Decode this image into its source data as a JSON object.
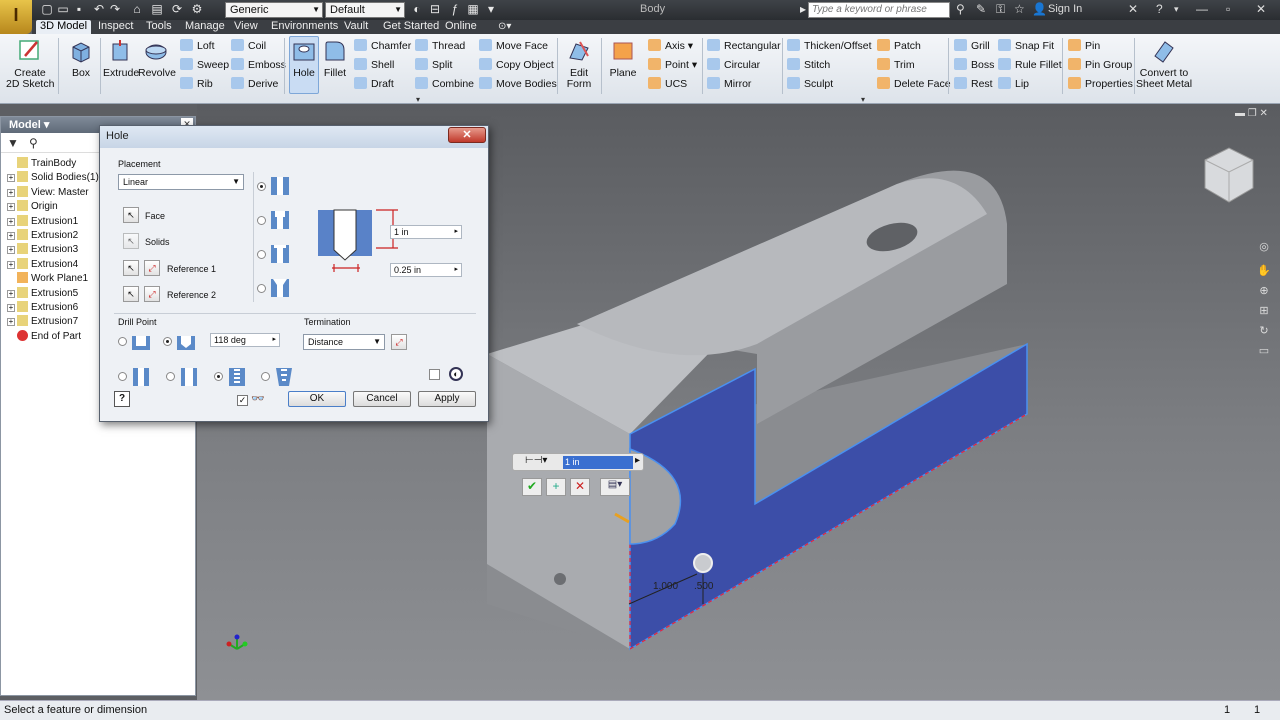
{
  "titlebar": {
    "app_logo": "I",
    "appearance_combo": "Generic",
    "material_combo": "Default",
    "document_title": "Body",
    "search_placeholder": "Type a keyword or phrase",
    "sign_in": "Sign In"
  },
  "tabs": [
    "3D Model",
    "Inspect",
    "Tools",
    "Manage",
    "View",
    "Environments",
    "Vault",
    "Get Started",
    "Online"
  ],
  "ribbon": {
    "create_sketch": "Create\n2D Sketch",
    "box": "Box",
    "extrude": "Extrude",
    "revolve": "Revolve",
    "col1": [
      "Loft",
      "Sweep",
      "Rib"
    ],
    "col2": [
      "Coil",
      "Emboss",
      "Derive"
    ],
    "hole": "Hole",
    "fillet": "Fillet",
    "col3": [
      "Chamfer",
      "Shell",
      "Draft"
    ],
    "col4": [
      "Thread",
      "Split",
      "Combine"
    ],
    "col5": [
      "Move Face",
      "Copy Object",
      "Move Bodies"
    ],
    "edit_form": "Edit\nForm",
    "plane": "Plane",
    "work_features": [
      "Axis",
      "Point",
      "UCS"
    ],
    "pattern": [
      "Rectangular",
      "Circular",
      "Mirror"
    ],
    "surface": [
      "Thicken/Offset",
      "Stitch",
      "Sculpt"
    ],
    "surface2": [
      "Patch",
      "Trim",
      "Delete Face"
    ],
    "plastic": [
      "Grill",
      "Boss",
      "Rest"
    ],
    "plastic2": [
      "Snap Fit",
      "Rule Fillet",
      "Lip"
    ],
    "harness": [
      "Pin",
      "Pin Group",
      "Properties"
    ],
    "convert": "Convert to\nSheet Metal"
  },
  "browser": {
    "header": "Model ▾",
    "items": [
      {
        "label": "TrainBody",
        "indent": 0,
        "expander": false
      },
      {
        "label": "Solid Bodies(1)",
        "indent": 1,
        "expander": true
      },
      {
        "label": "View: Master",
        "indent": 1,
        "expander": true
      },
      {
        "label": "Origin",
        "indent": 1,
        "expander": true
      },
      {
        "label": "Extrusion1",
        "indent": 1,
        "expander": true
      },
      {
        "label": "Extrusion2",
        "indent": 1,
        "expander": true
      },
      {
        "label": "Extrusion3",
        "indent": 1,
        "expander": true
      },
      {
        "label": "Extrusion4",
        "indent": 1,
        "expander": true
      },
      {
        "label": "Work Plane1",
        "indent": 1,
        "expander": false
      },
      {
        "label": "Extrusion5",
        "indent": 1,
        "expander": true
      },
      {
        "label": "Extrusion6",
        "indent": 1,
        "expander": true
      },
      {
        "label": "Extrusion7",
        "indent": 1,
        "expander": true
      },
      {
        "label": "End of Part",
        "indent": 1,
        "expander": false
      }
    ]
  },
  "dialog": {
    "title": "Hole",
    "close": "✕",
    "placement_label": "Placement",
    "placement_value": "Linear",
    "face": "Face",
    "solids": "Solids",
    "reference1": "Reference 1",
    "reference2": "Reference 2",
    "depth_value": "1 in",
    "diameter_value": "0.25 in",
    "drill_point_label": "Drill Point",
    "drill_angle": "118 deg",
    "termination_label": "Termination",
    "termination_value": "Distance",
    "ok": "OK",
    "cancel": "Cancel",
    "apply": "Apply",
    "help": "?"
  },
  "minitoolbar": {
    "value": "1 in"
  },
  "dimensions": [
    "1.000",
    ".500"
  ],
  "status": {
    "text": "Select a feature or dimension",
    "count1": "1",
    "count2": "1"
  }
}
